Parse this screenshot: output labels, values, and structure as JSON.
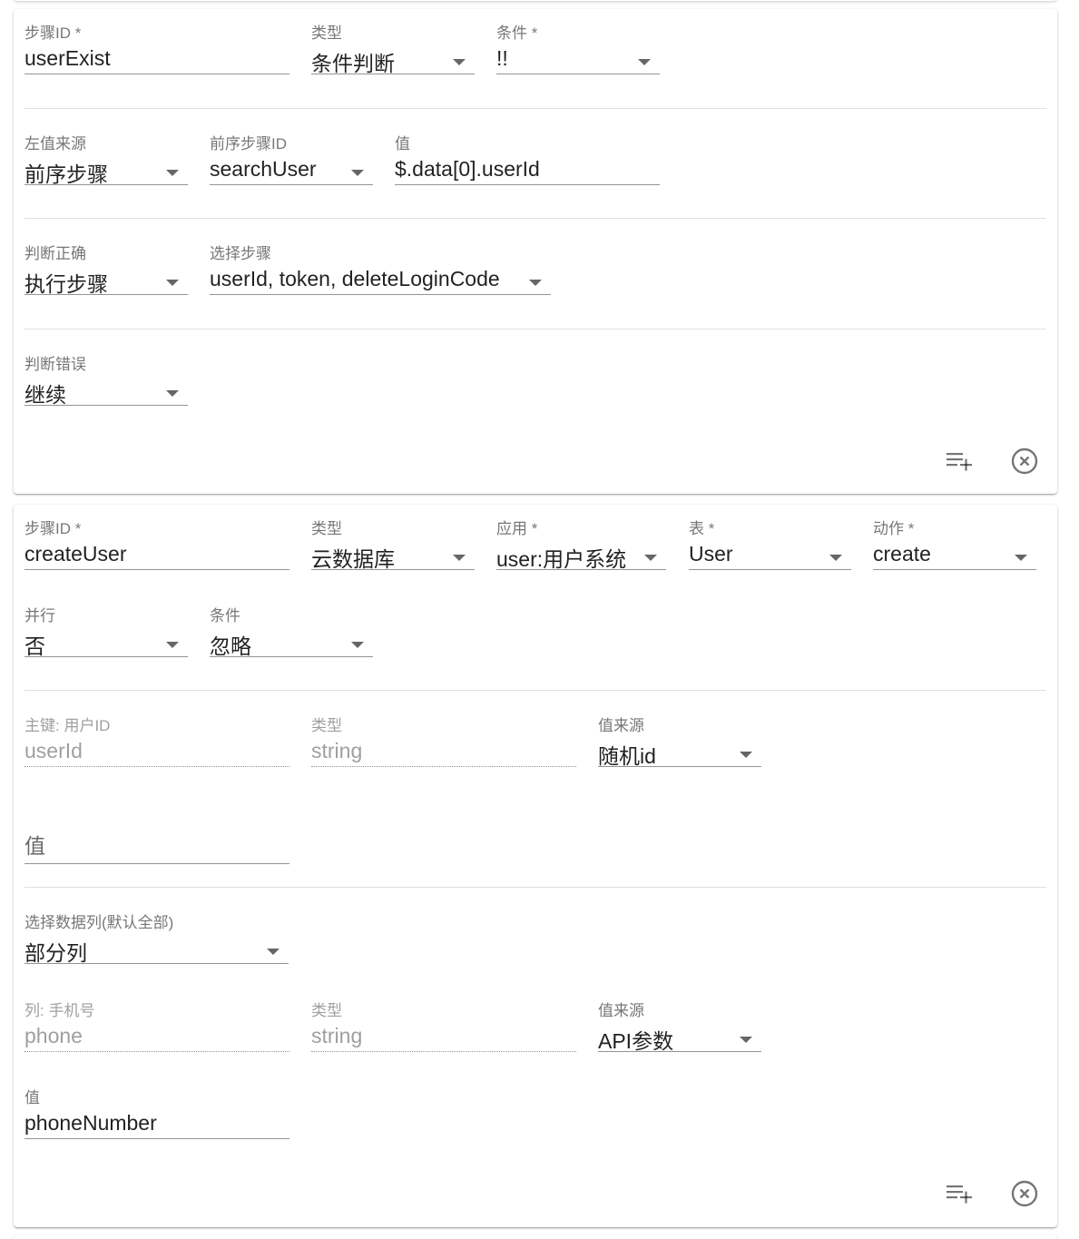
{
  "step1": {
    "step_id": {
      "label": "步骤ID *",
      "value": "userExist"
    },
    "type": {
      "label": "类型",
      "value": "条件判断"
    },
    "condition": {
      "label": "条件 *",
      "value": "!!"
    },
    "left_source": {
      "label": "左值来源",
      "value": "前序步骤"
    },
    "prev_step_id": {
      "label": "前序步骤ID",
      "value": "searchUser"
    },
    "value": {
      "label": "值",
      "value": "$.data[0].userId"
    },
    "on_true": {
      "label": "判断正确",
      "value": "执行步骤"
    },
    "select_steps": {
      "label": "选择步骤",
      "value": "userId, token, deleteLoginCode"
    },
    "on_false": {
      "label": "判断错误",
      "value": "继续"
    },
    "icons": {
      "add": "playlist-add-icon",
      "remove": "close-circle-icon"
    }
  },
  "step2": {
    "step_id": {
      "label": "步骤ID *",
      "value": "createUser"
    },
    "type": {
      "label": "类型",
      "value": "云数据库"
    },
    "app": {
      "label": "应用 *",
      "value": "user:用户系统"
    },
    "table": {
      "label": "表 *",
      "value": "User"
    },
    "action": {
      "label": "动作 *",
      "value": "create"
    },
    "parallel": {
      "label": "并行",
      "value": "否"
    },
    "condition": {
      "label": "条件",
      "value": "忽略"
    },
    "pk": {
      "label": "主键: 用户ID",
      "value": "userId",
      "type_label": "类型",
      "type_value": "string",
      "source_label": "值来源",
      "source_value": "随机id",
      "value_placeholder": "值"
    },
    "columns_select": {
      "label": "选择数据列(默认全部)",
      "value": "部分列"
    },
    "col_phone": {
      "label": "列: 手机号",
      "value": "phone",
      "type_label": "类型",
      "type_value": "string",
      "source_label": "值来源",
      "source_value": "API参数",
      "value_label": "值",
      "value_value": "phoneNumber"
    },
    "icons": {
      "add": "playlist-add-icon",
      "remove": "close-circle-icon"
    }
  }
}
